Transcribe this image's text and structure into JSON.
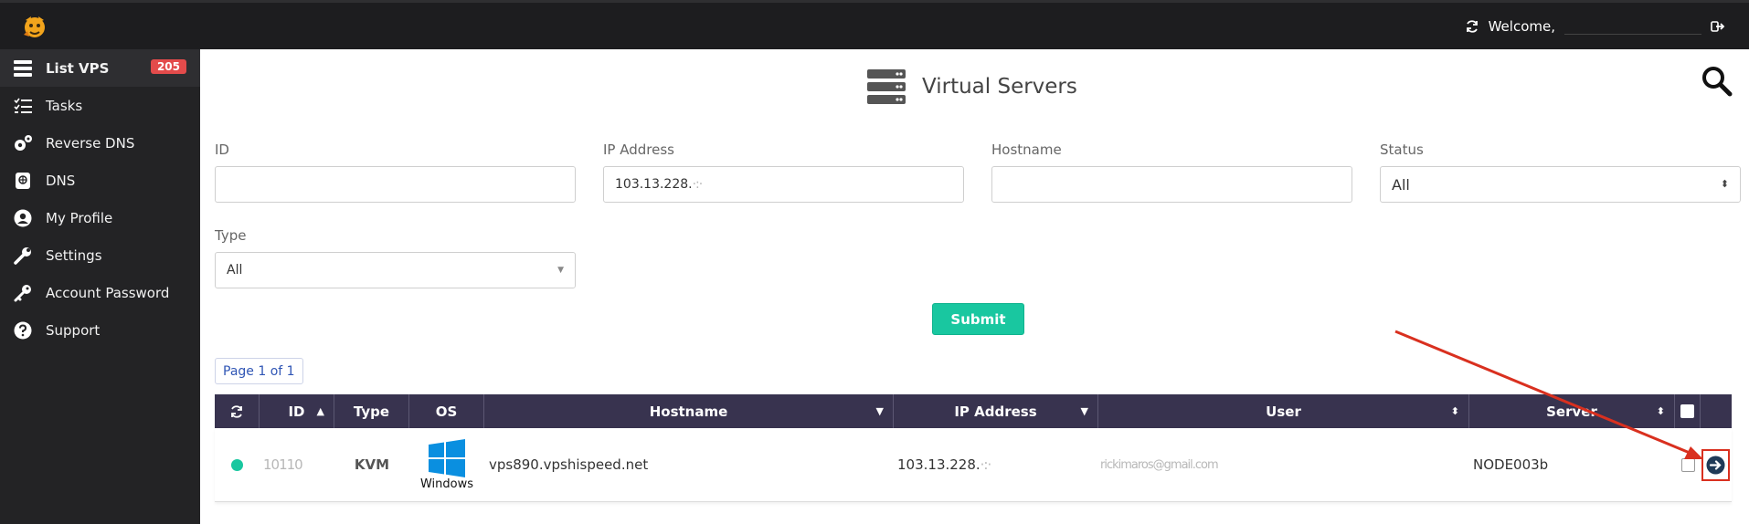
{
  "topbar": {
    "welcome": "Welcome,",
    "refresh_icon": "refresh-icon",
    "logout_icon": "logout-icon"
  },
  "sidebar": {
    "items": [
      {
        "label": "List VPS",
        "icon": "server-list-icon",
        "badge": "205",
        "active": true
      },
      {
        "label": "Tasks",
        "icon": "tasks-icon"
      },
      {
        "label": "Reverse DNS",
        "icon": "gears-icon"
      },
      {
        "label": "DNS",
        "icon": "dns-icon"
      },
      {
        "label": "My Profile",
        "icon": "user-icon"
      },
      {
        "label": "Settings",
        "icon": "wrench-icon"
      },
      {
        "label": "Account Password",
        "icon": "key-icon"
      },
      {
        "label": "Support",
        "icon": "question-icon"
      }
    ]
  },
  "page": {
    "title": "Virtual Servers"
  },
  "filters": {
    "id_label": "ID",
    "id_value": "",
    "ip_label": "IP Address",
    "ip_value": "103.13.228.",
    "hostname_label": "Hostname",
    "hostname_value": "",
    "status_label": "Status",
    "status_value": "All",
    "type_label": "Type",
    "type_value": "All",
    "submit_label": "Submit"
  },
  "pager": {
    "text": "Page 1 of 1"
  },
  "table": {
    "headers": {
      "id": "ID",
      "type": "Type",
      "os": "OS",
      "hostname": "Hostname",
      "ip": "IP Address",
      "user": "User",
      "server": "Server"
    },
    "rows": [
      {
        "status_color": "#19c7a0",
        "id": "10110",
        "type": "KVM",
        "os_label": "Windows",
        "hostname": "vps890.vpshispeed.net",
        "ip": "103.13.228.",
        "user": "rickimaros@gmail.com",
        "server": "NODE003b"
      }
    ]
  },
  "colors": {
    "accent": "#19c7a0",
    "header_bg": "#38334f",
    "badge": "#e34b4b",
    "annotation": "#d9301f"
  }
}
